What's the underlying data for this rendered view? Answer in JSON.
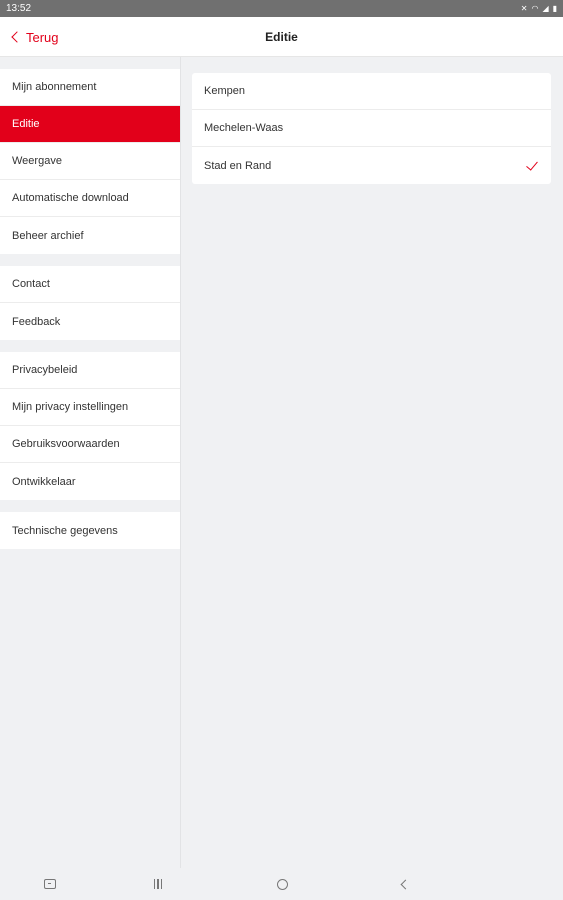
{
  "status_bar": {
    "time": "13:52"
  },
  "nav": {
    "back_label": "Terug",
    "title": "Editie"
  },
  "sidebar": {
    "groups": [
      {
        "items": [
          {
            "label": "Mijn abonnement",
            "active": false
          },
          {
            "label": "Editie",
            "active": true
          },
          {
            "label": "Weergave",
            "active": false
          },
          {
            "label": "Automatische download",
            "active": false
          },
          {
            "label": "Beheer archief",
            "active": false
          }
        ]
      },
      {
        "items": [
          {
            "label": "Contact",
            "active": false
          },
          {
            "label": "Feedback",
            "active": false
          }
        ]
      },
      {
        "items": [
          {
            "label": "Privacybeleid",
            "active": false
          },
          {
            "label": "Mijn privacy instellingen",
            "active": false
          },
          {
            "label": "Gebruiksvoorwaarden",
            "active": false
          },
          {
            "label": "Ontwikkelaar",
            "active": false
          }
        ]
      },
      {
        "items": [
          {
            "label": "Technische gegevens",
            "active": false
          }
        ]
      }
    ]
  },
  "editions": {
    "options": [
      {
        "label": "Kempen",
        "selected": false
      },
      {
        "label": "Mechelen-Waas",
        "selected": false
      },
      {
        "label": "Stad en Rand",
        "selected": true
      }
    ]
  },
  "colors": {
    "accent": "#e2001a",
    "background": "#f0f1f3",
    "status_bar": "#707070"
  },
  "icons": {
    "status": [
      "mute-icon",
      "wifi-icon",
      "signal-icon",
      "battery-icon"
    ],
    "system_nav": [
      "keyboard-icon",
      "recents-icon",
      "home-icon",
      "back-icon"
    ],
    "back": "chevron-left-icon",
    "selected": "checkmark-icon"
  }
}
